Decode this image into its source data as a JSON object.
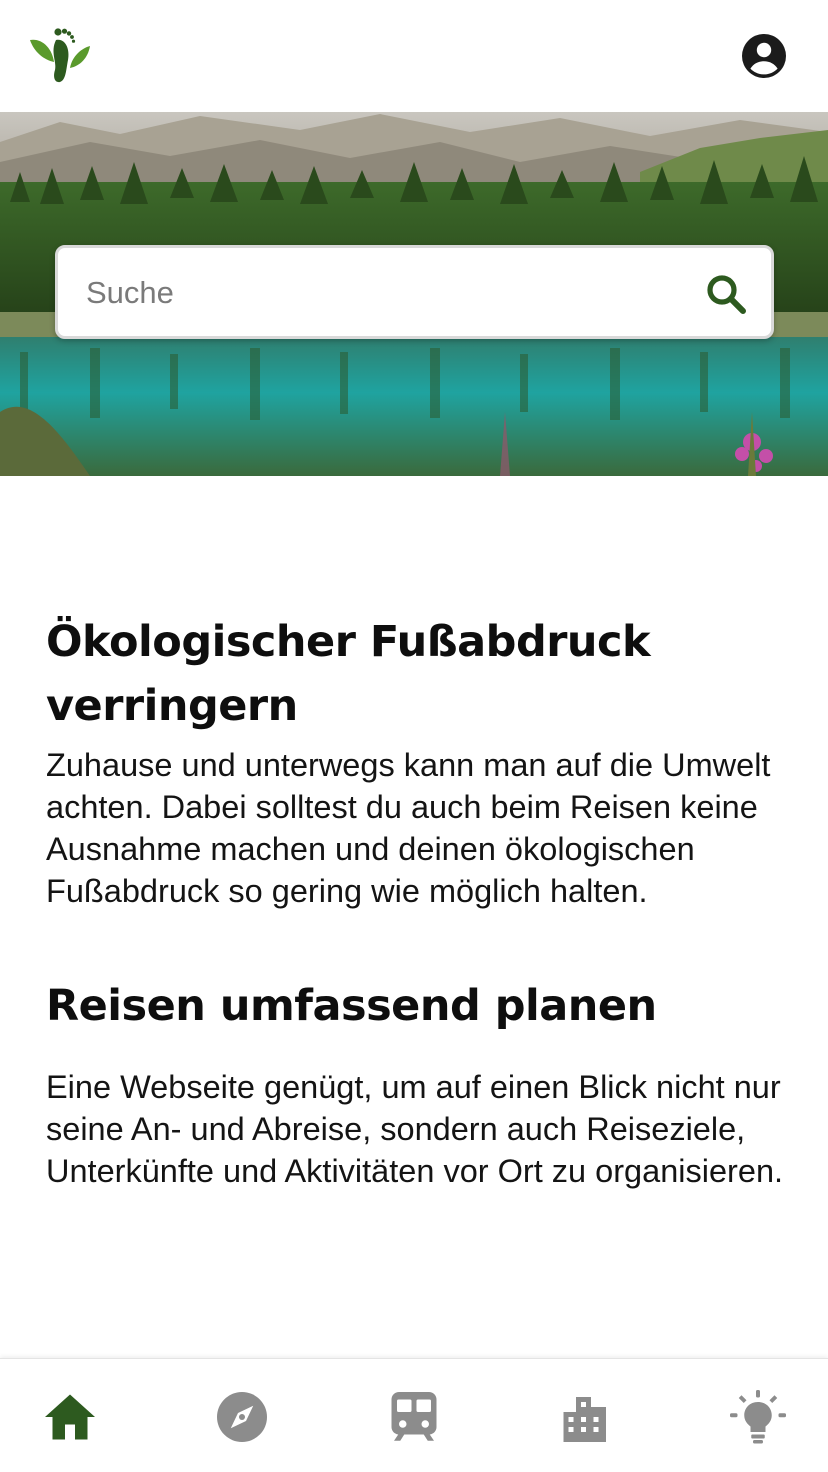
{
  "header": {
    "logo_icon": "footprint-leaves-logo",
    "account_icon": "account-circle-icon"
  },
  "search": {
    "placeholder": "Suche",
    "value": "",
    "icon": "search-icon"
  },
  "main": {
    "section1": {
      "title": "Ökologischer Fußabdruck verringern",
      "text": "Zuhause und unterwegs kann man auf die Umwelt achten. Dabei solltest du auch beim Reisen keine Ausnahme machen und deinen ökologischen Fußabdruck so gering wie möglich halten."
    },
    "section2": {
      "title": "Reisen umfassend planen",
      "text": "Eine Webseite genügt, um auf einen Blick nicht nur seine An- und Abreise, sondern auch Reiseziele, Unterkünfte und Aktivitäten vor Ort zu organisieren."
    }
  },
  "bottom_nav": {
    "items": [
      {
        "icon": "home-icon",
        "active": true
      },
      {
        "icon": "compass-icon",
        "active": false
      },
      {
        "icon": "train-icon",
        "active": false
      },
      {
        "icon": "city-icon",
        "active": false
      },
      {
        "icon": "lightbulb-icon",
        "active": false
      }
    ]
  },
  "colors": {
    "accent": "#2d5a1f",
    "inactive_icon": "#8c8c8c",
    "text": "#111111",
    "background": "#ffffff"
  }
}
